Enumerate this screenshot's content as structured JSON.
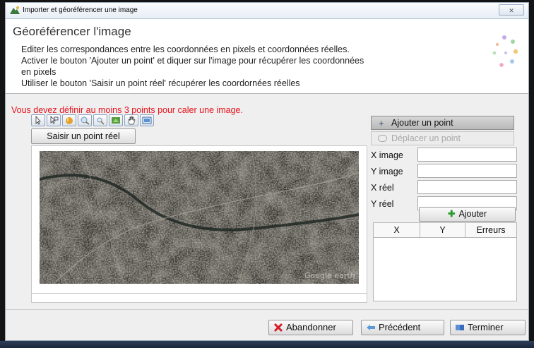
{
  "window": {
    "title": "Importer et géoréférencer une image",
    "close_label": "✕"
  },
  "header": {
    "title": "Géoréférencer l'image",
    "lines": [
      "Editer les correspondances entre les coordonnées en pixels et coordonnées réelles.",
      "Activer le bouton 'Ajouter un point' et diquer sur l'image pour récupérer les coordonnées",
      "en pixels",
      "Utiliser le bouton 'Saisir un point réel' récupérer les coordornées réelles"
    ]
  },
  "warning": "Vous devez définir au moins 3 points pour caler une image.",
  "toolbar": {
    "tools": [
      "select-arrow-icon",
      "select-multi-icon",
      "pan-hand-color-icon",
      "zoom-in-icon",
      "zoom-out-icon",
      "refresh-icon",
      "hand-icon",
      "fit-extent-icon"
    ]
  },
  "saisir_button": "Saisir un point réel",
  "map": {
    "watermark": "Google earth"
  },
  "right_panel": {
    "ajouter_point": "Ajouter un point",
    "deplacer_point": "Déplacer un point",
    "fields": [
      {
        "label": "X image",
        "value": ""
      },
      {
        "label": "Y image",
        "value": ""
      },
      {
        "label": "X réel",
        "value": ""
      },
      {
        "label": "Y réel",
        "value": ""
      }
    ],
    "ajouter": "Ajouter",
    "table_headers": [
      "X",
      "Y",
      "Erreurs"
    ]
  },
  "footer": {
    "abandonner": "Abandonner",
    "precedent": "Précédent",
    "terminer": "Terminer"
  },
  "colors": {
    "warning": "#e8121c",
    "accent": "#2d9a2d"
  }
}
